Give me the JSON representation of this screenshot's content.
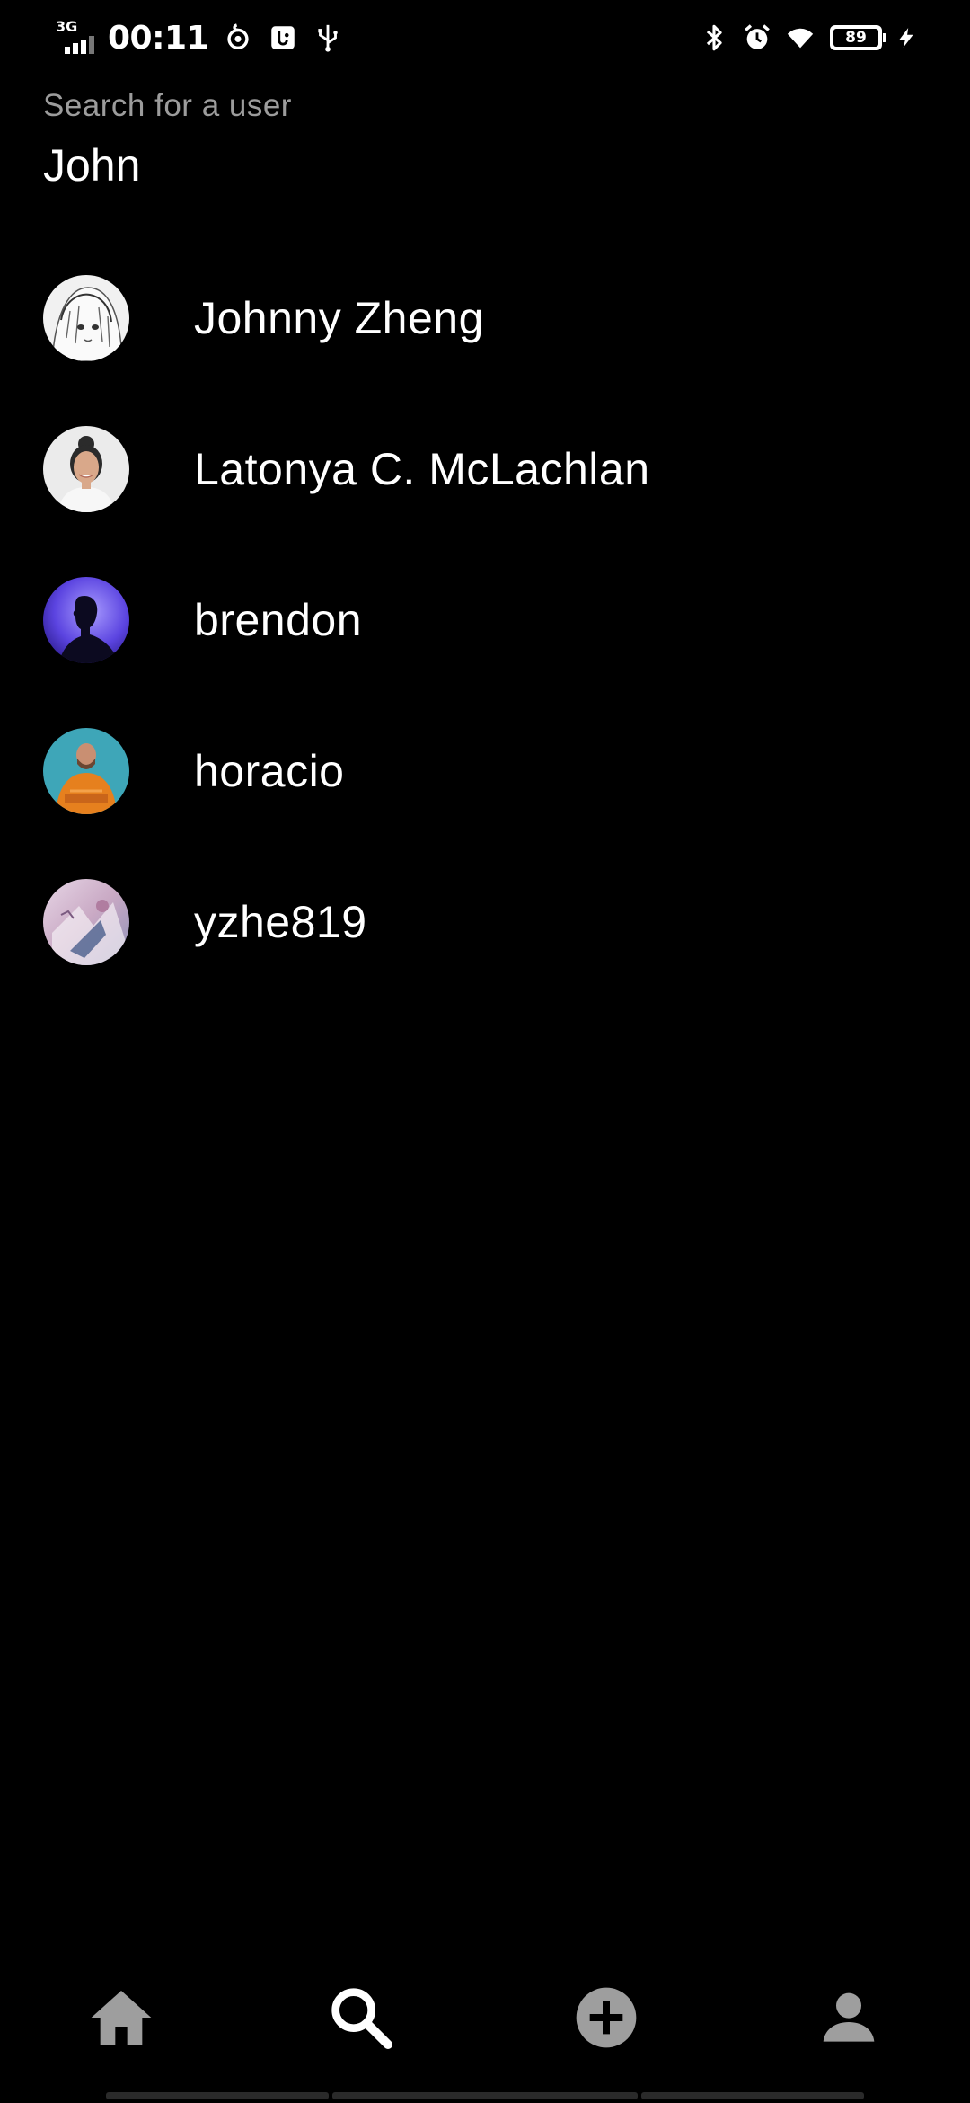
{
  "status_bar": {
    "network_type": "3G",
    "time": "00:11",
    "battery_level": "89",
    "icons": [
      "signal-icon",
      "sync-icon",
      "usb-debug-icon",
      "usb-icon",
      "bluetooth-icon",
      "alarm-icon",
      "wifi-icon",
      "battery-icon",
      "charging-icon"
    ]
  },
  "search": {
    "label": "Search for a user",
    "value": "John"
  },
  "results": [
    {
      "name": "Johnny Zheng",
      "avatar": "anime-sketch-avatar"
    },
    {
      "name": "Latonya C. McLachlan",
      "avatar": "woman-photo-avatar"
    },
    {
      "name": "brendon",
      "avatar": "silhouette-purple-avatar"
    },
    {
      "name": "horacio",
      "avatar": "man-orange-sweater-avatar"
    },
    {
      "name": "yzhe819",
      "avatar": "anime-pastel-avatar"
    }
  ],
  "bottom_nav": {
    "items": [
      {
        "icon": "home-icon",
        "active": false
      },
      {
        "icon": "search-icon",
        "active": true
      },
      {
        "icon": "add-circle-icon",
        "active": false
      },
      {
        "icon": "profile-icon",
        "active": false
      }
    ],
    "active_color": "#ffffff",
    "inactive_color": "#9e9e9e"
  },
  "colors": {
    "background": "#000000",
    "text_primary": "#ffffff",
    "text_secondary": "#9c9c9c"
  }
}
